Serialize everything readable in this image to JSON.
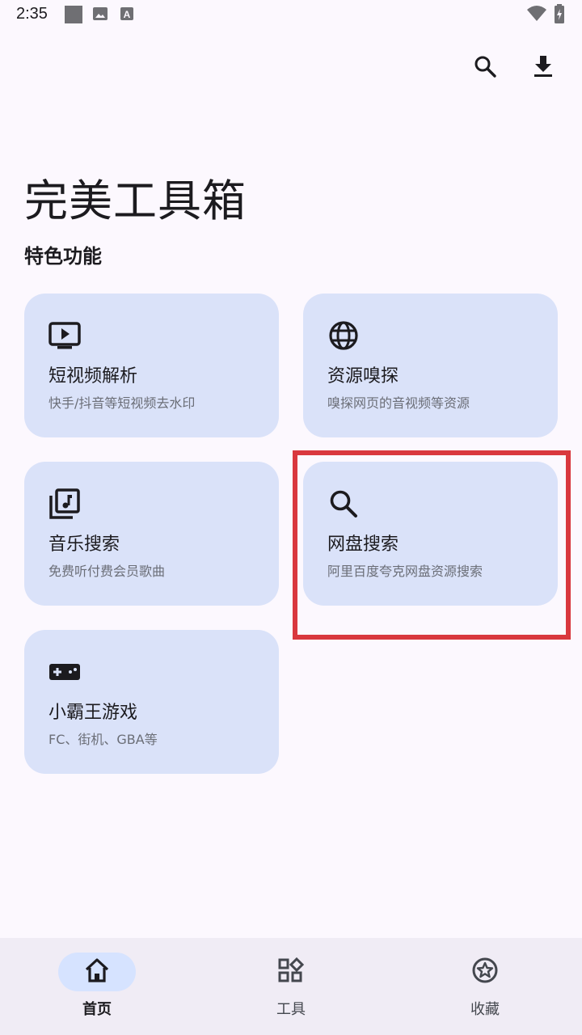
{
  "status_bar": {
    "time": "2:35",
    "icons": [
      "square-notification-icon",
      "image-notification-icon",
      "a-notification-icon",
      "wifi-icon",
      "battery-charging-icon"
    ]
  },
  "top_bar": {
    "actions": [
      "search-icon",
      "download-icon"
    ]
  },
  "app_title": "完美工具箱",
  "section_title": "特色功能",
  "cards": [
    {
      "title": "短视频解析",
      "subtitle": "快手/抖音等短视频去水印",
      "icon": "tv-play-icon"
    },
    {
      "title": "资源嗅探",
      "subtitle": "嗅探网页的音视频等资源",
      "icon": "globe-icon"
    },
    {
      "title": "音乐搜索",
      "subtitle": "免费听付费会员歌曲",
      "icon": "music-library-icon"
    },
    {
      "title": "网盘搜索",
      "subtitle": "阿里百度夸克网盘资源搜索",
      "icon": "search-icon"
    },
    {
      "title": "小霸王游戏",
      "subtitle": "FC、街机、GBA等",
      "icon": "gamepad-icon"
    }
  ],
  "bottom_nav": [
    {
      "label": "首页",
      "icon": "home-icon",
      "active": true
    },
    {
      "label": "工具",
      "icon": "widgets-icon",
      "active": false
    },
    {
      "label": "收藏",
      "icon": "star-circle-icon",
      "active": false
    }
  ],
  "colors": {
    "background": "#fcf8fe",
    "card": "#dae2f9",
    "nav_background": "#f0ecf5",
    "nav_active_pill": "#d6e3ff",
    "highlight": "#d9383e"
  }
}
